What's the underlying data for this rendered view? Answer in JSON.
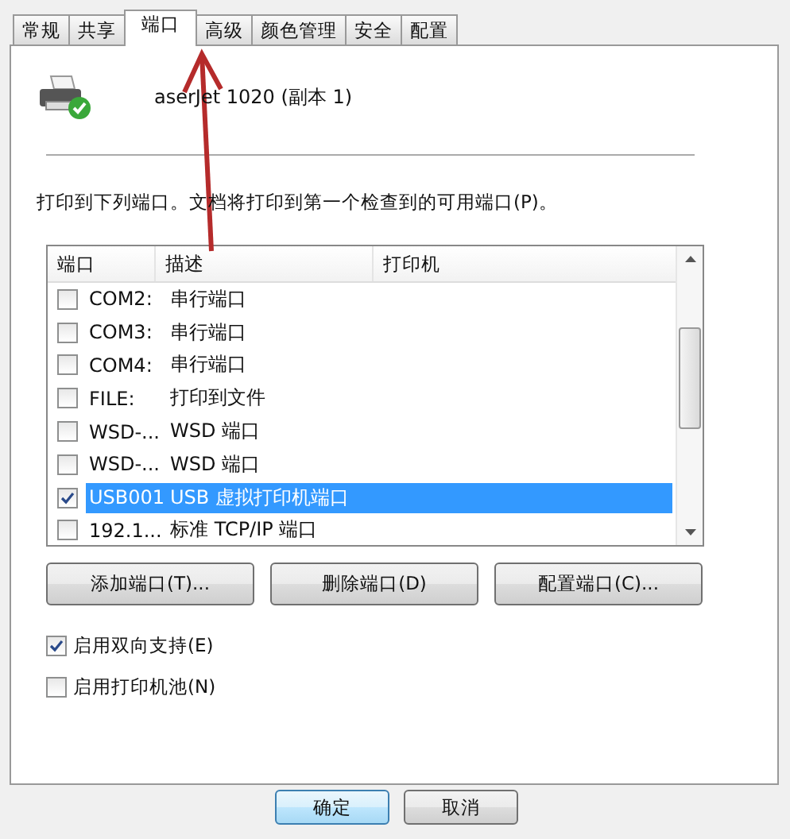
{
  "tabs": [
    {
      "label": "常规",
      "selected": false
    },
    {
      "label": "共享",
      "selected": false
    },
    {
      "label": "端口",
      "selected": true
    },
    {
      "label": "高级",
      "selected": false
    },
    {
      "label": "颜色管理",
      "selected": false
    },
    {
      "label": "安全",
      "selected": false
    },
    {
      "label": "配置",
      "selected": false
    }
  ],
  "printer_name": "aserJet 1020 (副本 1)",
  "instruction": "打印到下列端口。文档将打印到第一个检查到的可用端口(P)。",
  "port_table": {
    "columns": [
      "端口",
      "描述",
      "打印机"
    ],
    "rows": [
      {
        "port": "COM2:",
        "description": "串行端口",
        "checked": false,
        "selected": false
      },
      {
        "port": "COM3:",
        "description": "串行端口",
        "checked": false,
        "selected": false
      },
      {
        "port": "COM4:",
        "description": "串行端口",
        "checked": false,
        "selected": false
      },
      {
        "port": "FILE:",
        "description": "打印到文件",
        "checked": false,
        "selected": false
      },
      {
        "port": "WSD-...",
        "description": "WSD 端口",
        "checked": false,
        "selected": false
      },
      {
        "port": "WSD-...",
        "description": "WSD 端口",
        "checked": false,
        "selected": false
      },
      {
        "port": "USB001",
        "description": "USB 虚拟打印机端口",
        "checked": true,
        "selected": true
      },
      {
        "port": "192.1...",
        "description": "标准 TCP/IP 端口",
        "checked": false,
        "selected": false
      }
    ]
  },
  "port_buttons": [
    "添加端口(T)...",
    "删除端口(D)",
    "配置端口(C)..."
  ],
  "options": [
    {
      "label": "启用双向支持(E)",
      "checked": true
    },
    {
      "label": "启用打印机池(N)",
      "checked": false
    }
  ],
  "dialog_buttons": [
    {
      "label": "确定",
      "default": true
    },
    {
      "label": "取消",
      "default": false
    }
  ]
}
